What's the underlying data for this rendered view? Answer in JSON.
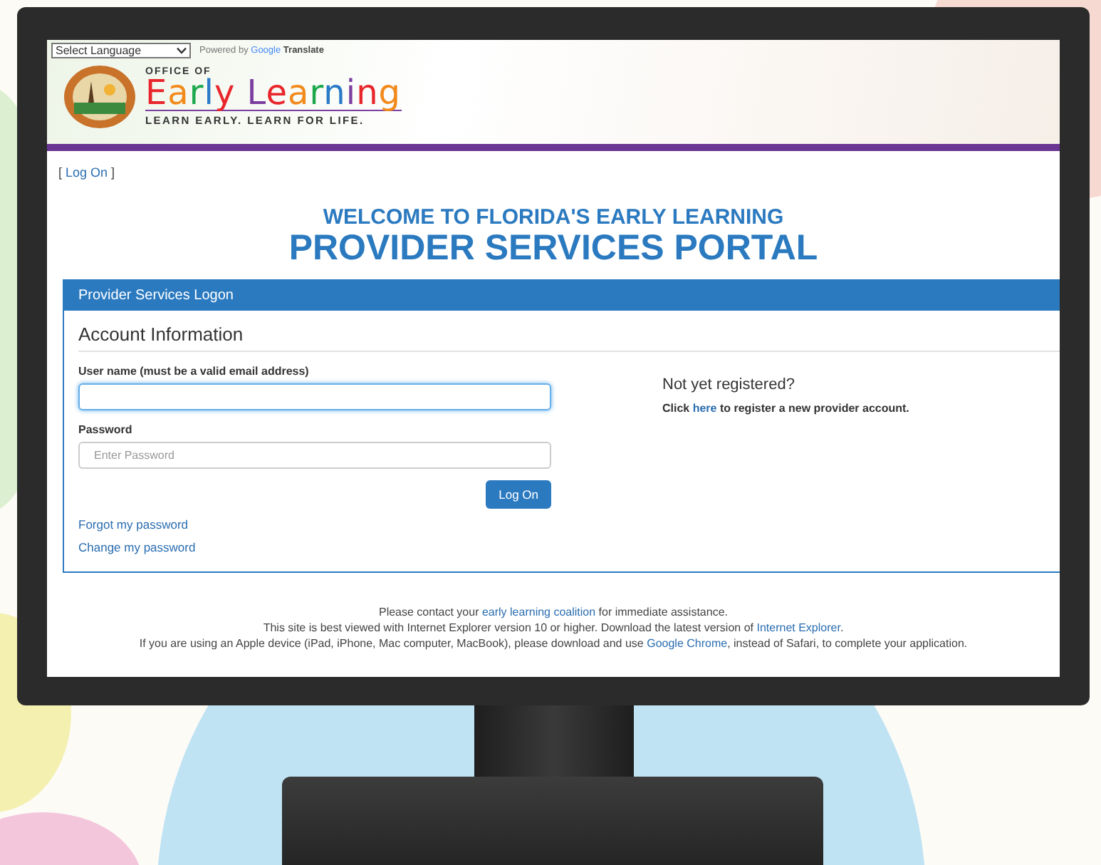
{
  "language_select": {
    "value": "Select Language"
  },
  "translate_credit": {
    "prefix": "Powered by",
    "brand": "Google",
    "product": "Translate"
  },
  "logo": {
    "office": "OFFICE OF",
    "name": "Early Learning",
    "tagline": "LEARN EARLY. LEARN FOR LIFE."
  },
  "login_link": {
    "before": "[ ",
    "link": "Log On",
    "after": " ]"
  },
  "heading": {
    "line1": "WELCOME TO FLORIDA'S EARLY LEARNING",
    "line2": "PROVIDER SERVICES PORTAL"
  },
  "panel": {
    "title": "Provider Services Logon",
    "section": "Account Information",
    "fields": [
      {
        "label": "User name (must be a valid email address)",
        "focused": true
      },
      {
        "label": "Password",
        "placeholder": "Enter Password",
        "focused": false
      }
    ],
    "button": "Log On",
    "links": [
      "Forgot my password",
      "Change my password"
    ],
    "register_title": "Not yet registered?",
    "register_text": {
      "before": "Click ",
      "link": "here",
      "after": " to register a new provider account."
    }
  },
  "footer": [
    {
      "before": "Please contact your ",
      "link": "early learning coalition",
      "after": " for immediate assistance."
    },
    {
      "before": "This site is best viewed with Internet Explorer version 10 or higher. Download the latest version of ",
      "link": "Internet Explorer",
      "after": "."
    },
    {
      "before": "If you are using an Apple device (iPad, iPhone, Mac computer, MacBook), please download and use ",
      "link": "Google Chrome",
      "after": ", instead of Safari, to complete your application."
    }
  ]
}
